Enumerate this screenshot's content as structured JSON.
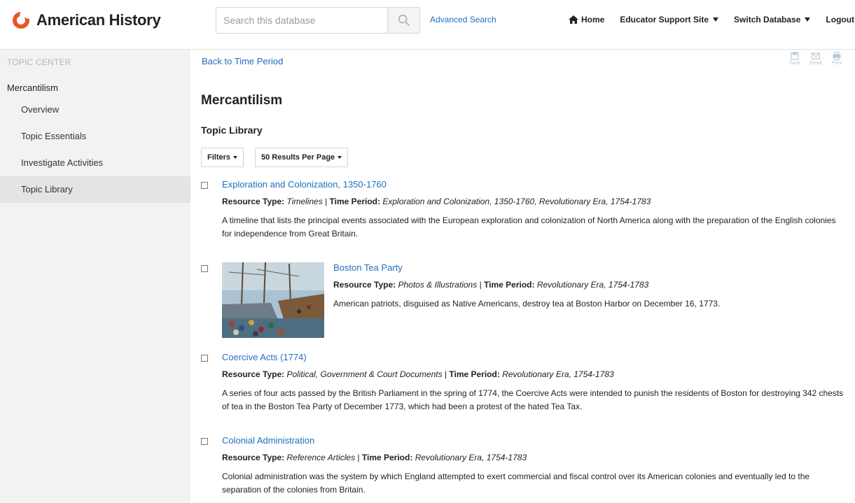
{
  "header": {
    "logo_text": "American History",
    "search_placeholder": "Search this database",
    "advanced_search": "Advanced Search",
    "nav": {
      "home": "Home",
      "educator": "Educator Support Site",
      "switch_db": "Switch Database",
      "logout": "Logout"
    }
  },
  "sidebar": {
    "heading": "TOPIC CENTER",
    "topic": "Mercantilism",
    "items": [
      {
        "label": "Overview"
      },
      {
        "label": "Topic Essentials"
      },
      {
        "label": "Investigate Activities"
      },
      {
        "label": "Topic Library"
      }
    ]
  },
  "main": {
    "back_link": "Back to Time Period",
    "tools": {
      "save": "Save",
      "email": "Email",
      "print": "Print"
    },
    "title": "Mercantilism",
    "section": "Topic Library",
    "filters_label": "Filters",
    "per_page_label": "50 Results Per Page",
    "results": [
      {
        "title": "Exploration and Colonization, 1350-1760",
        "resource_type_label": "Resource Type:",
        "resource_type": "Timelines",
        "time_period_label": "Time Period:",
        "time_period": "Exploration and Colonization, 1350-1760, Revolutionary Era, 1754-1783",
        "description": "A timeline that lists the principal events associated with the European exploration and colonization of North America along with the preparation of the English colonies for independence from Great Britain."
      },
      {
        "title": "Boston Tea Party",
        "resource_type_label": "Resource Type:",
        "resource_type": "Photos & Illustrations",
        "time_period_label": "Time Period:",
        "time_period": "Revolutionary Era, 1754-1783",
        "description": "American patriots, disguised as Native Americans, destroy tea at Boston Harbor on December 16, 1773."
      },
      {
        "title": "Coercive Acts (1774)",
        "resource_type_label": "Resource Type:",
        "resource_type": "Political, Government & Court Documents",
        "time_period_label": "Time Period:",
        "time_period": "Revolutionary Era, 1754-1783",
        "description": "A series of four acts passed by the British Parliament in the spring of 1774, the Coercive Acts were intended to punish the residents of Boston for destroying 342 chests of tea in the Boston Tea Party of December 1773, which had been a protest of the hated Tea Tax."
      },
      {
        "title": "Colonial Administration",
        "resource_type_label": "Resource Type:",
        "resource_type": "Reference Articles",
        "time_period_label": "Time Period:",
        "time_period": "Revolutionary Era, 1754-1783",
        "description": "Colonial administration was the system by which England attempted to exert commercial and fiscal control over its American colonies and eventually led to the separation of the colonies from Britain."
      }
    ]
  },
  "colors": {
    "link": "#1e6fc0",
    "brand": "#e8542a",
    "sidebar_bg": "#f2f2f2",
    "sidebar_active": "#e4e4e4"
  }
}
